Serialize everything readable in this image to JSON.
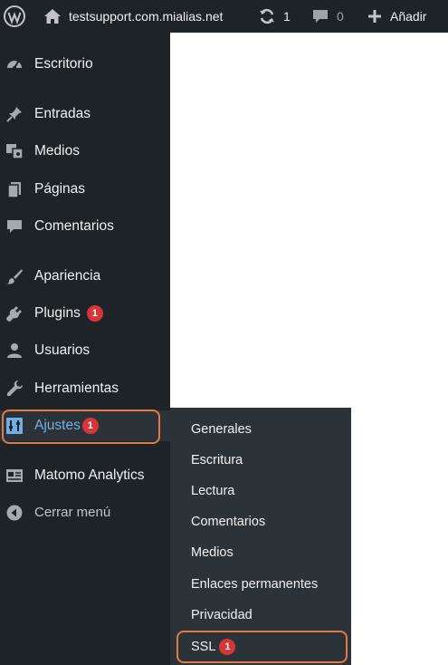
{
  "adminbar": {
    "wp_logo_icon": "wordpress-logo-icon",
    "site_name": "testsupport.com.mialias.net",
    "updates_count": "1",
    "comments_count": "0",
    "new_label": "Añadir"
  },
  "sidebar": {
    "items": [
      {
        "label": "Escritorio",
        "icon": "dashboard-icon"
      },
      {
        "label": "Entradas",
        "icon": "pin-icon"
      },
      {
        "label": "Medios",
        "icon": "media-icon"
      },
      {
        "label": "Páginas",
        "icon": "pages-icon"
      },
      {
        "label": "Comentarios",
        "icon": "comments-icon"
      },
      {
        "label": "Apariencia",
        "icon": "brush-icon"
      },
      {
        "label": "Plugins",
        "icon": "plugin-icon",
        "badge": "1"
      },
      {
        "label": "Usuarios",
        "icon": "users-icon"
      },
      {
        "label": "Herramientas",
        "icon": "wrench-icon"
      },
      {
        "label": "Ajustes",
        "icon": "settings-icon",
        "badge": "1"
      },
      {
        "label": "Matomo Analytics",
        "icon": "analytics-icon"
      },
      {
        "label": "Cerrar menú",
        "icon": "collapse-icon"
      }
    ]
  },
  "submenu": {
    "items": [
      {
        "label": "Generales"
      },
      {
        "label": "Escritura"
      },
      {
        "label": "Lectura"
      },
      {
        "label": "Comentarios"
      },
      {
        "label": "Medios"
      },
      {
        "label": "Enlaces permanentes"
      },
      {
        "label": "Privacidad"
      },
      {
        "label": "SSL",
        "badge": "1"
      }
    ]
  },
  "colors": {
    "bar_bg": "#1d2327",
    "submenu_bg": "#2c3338",
    "accent": "#72aee6",
    "badge": "#d63638",
    "highlight": "#e07a46"
  }
}
